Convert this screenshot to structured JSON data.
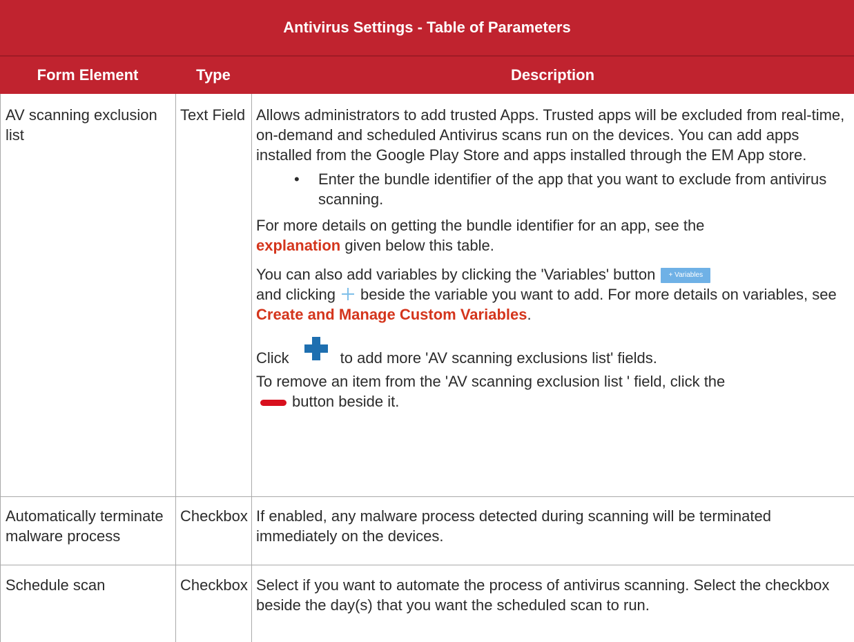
{
  "table": {
    "title": "Antivirus Settings - Table of Parameters",
    "headers": {
      "element": "Form Element",
      "type": "Type",
      "description": "Description"
    }
  },
  "rows": [
    {
      "element": "AV scanning exclusion list",
      "type": "Text Field",
      "p1": "Allows administrators to add trusted Apps. Trusted apps will be excluded from real-time, on-demand and scheduled Antivirus scans run on the devices. You can add apps installed from the Google Play Store and apps installed through the EM App store.",
      "bullet": "Enter the bundle identifier of the app that you want to exclude from antivirus scanning.",
      "p2_before": "For more details on getting the bundle identifier for an app, see the",
      "p2_link": "explanation",
      "p2_after": "given below this table.",
      "p3_part1": "You can also add variables by clicking the 'Variables' button",
      "variables_button": "+ Variables",
      "p3_part2": "and clicking",
      "p3_part3": "beside the variable you want to add. For more details on variables, see",
      "p3_link": "Create and Manage Custom Variables",
      "p3_end": ".",
      "p4_before": "Click",
      "p4_after": "to add more 'AV scanning exclusions list' fields.",
      "p5_before": "To remove an item from the 'AV scanning exclusion list ' field, click the",
      "p5_after": "button beside it."
    },
    {
      "element": "Automatically terminate malware process",
      "type": "Checkbox",
      "desc": "If enabled, any malware process detected during scanning will be terminated immediately on the devices."
    },
    {
      "element": "Schedule scan",
      "type": "Checkbox",
      "desc": "Select if you want to automate the process of antivirus scanning. Select the checkbox beside the day(s) that you want the scheduled scan to run."
    }
  ],
  "colors": {
    "header_red": "#c0232f",
    "link_red": "#d4351c",
    "border_gray": "#a9a9a9",
    "plus_blue": "#1e6fb0",
    "minus_red": "#d8101e"
  }
}
